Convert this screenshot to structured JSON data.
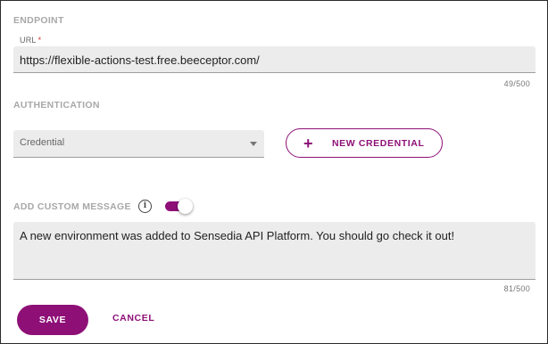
{
  "endpoint": {
    "section_title": "ENDPOINT",
    "url_label": "URL",
    "required_mark": "*",
    "url_value": "https://flexible-actions-test.free.beeceptor.com/",
    "counter": "49/500"
  },
  "authentication": {
    "section_title": "AUTHENTICATION",
    "credential_placeholder": "Credential",
    "new_credential_icon": "plus-icon",
    "new_credential_label": "NEW CREDENTIAL"
  },
  "custom_message": {
    "section_title": "ADD CUSTOM MESSAGE",
    "info_icon": "info-icon",
    "toggle_on": true,
    "message": "A new environment was added to Sensedia API Platform. You should go check it out!",
    "counter": "81/500"
  },
  "actions": {
    "save_label": "SAVE",
    "cancel_label": "CANCEL"
  },
  "colors": {
    "accent": "#8e1077",
    "field_bg": "#ececec",
    "section_title": "#a8a8a8",
    "required": "#d32f2f"
  }
}
